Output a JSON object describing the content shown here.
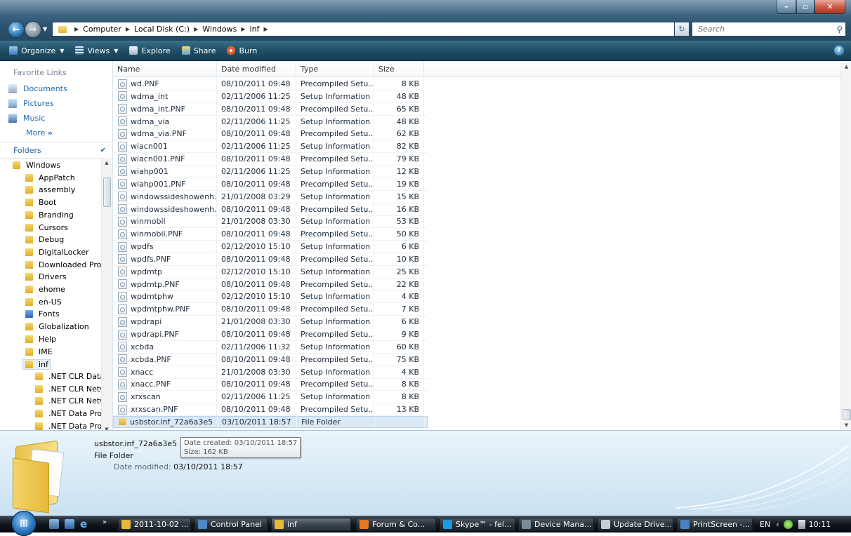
{
  "address": {
    "crumbs": [
      "Computer",
      "Local Disk (C:)",
      "Windows",
      "inf"
    ],
    "search_placeholder": "Search"
  },
  "toolbar": {
    "organize": "Organize",
    "views": "Views",
    "explore": "Explore",
    "share": "Share",
    "burn": "Burn"
  },
  "favorites": {
    "title": "Favorite Links",
    "items": [
      "Documents",
      "Pictures",
      "Music"
    ],
    "more": "More"
  },
  "folders": {
    "title": "Folders",
    "tree": [
      {
        "label": "Windows",
        "level": 1
      },
      {
        "label": "AppPatch",
        "level": 2
      },
      {
        "label": "assembly",
        "level": 2
      },
      {
        "label": "Boot",
        "level": 2
      },
      {
        "label": "Branding",
        "level": 2
      },
      {
        "label": "Cursors",
        "level": 2
      },
      {
        "label": "Debug",
        "level": 2
      },
      {
        "label": "DigitalLocker",
        "level": 2
      },
      {
        "label": "Downloaded Pro",
        "level": 2
      },
      {
        "label": "Drivers",
        "level": 2
      },
      {
        "label": "ehome",
        "level": 2
      },
      {
        "label": "en-US",
        "level": 2
      },
      {
        "label": "Fonts",
        "level": 2,
        "icon": "fonts"
      },
      {
        "label": "Globalization",
        "level": 2
      },
      {
        "label": "Help",
        "level": 2
      },
      {
        "label": "IME",
        "level": 2
      },
      {
        "label": "inf",
        "level": 2,
        "selected": true
      },
      {
        "label": ".NET CLR Data",
        "level": 3
      },
      {
        "label": ".NET CLR Netw",
        "level": 3
      },
      {
        "label": ".NET CLR Netw",
        "level": 3
      },
      {
        "label": ".NET Data Prov",
        "level": 3
      },
      {
        "label": ".NET Data Prov",
        "level": 3
      }
    ]
  },
  "columns": {
    "name": "Name",
    "date": "Date modified",
    "type": "Type",
    "size": "Size"
  },
  "files": [
    {
      "name": "wd.PNF",
      "date": "08/10/2011 09:48",
      "type": "Precompiled Setu...",
      "size": "8 KB"
    },
    {
      "name": "wdma_int",
      "date": "02/11/2006 11:25",
      "type": "Setup Information",
      "size": "48 KB"
    },
    {
      "name": "wdma_int.PNF",
      "date": "08/10/2011 09:48",
      "type": "Precompiled Setu...",
      "size": "65 KB"
    },
    {
      "name": "wdma_via",
      "date": "02/11/2006 11:25",
      "type": "Setup Information",
      "size": "48 KB"
    },
    {
      "name": "wdma_via.PNF",
      "date": "08/10/2011 09:48",
      "type": "Precompiled Setu...",
      "size": "62 KB"
    },
    {
      "name": "wiacn001",
      "date": "02/11/2006 11:25",
      "type": "Setup Information",
      "size": "82 KB"
    },
    {
      "name": "wiacn001.PNF",
      "date": "08/10/2011 09:48",
      "type": "Precompiled Setu...",
      "size": "79 KB"
    },
    {
      "name": "wiahp001",
      "date": "02/11/2006 11:25",
      "type": "Setup Information",
      "size": "12 KB"
    },
    {
      "name": "wiahp001.PNF",
      "date": "08/10/2011 09:48",
      "type": "Precompiled Setu...",
      "size": "19 KB"
    },
    {
      "name": "windowssideshowenh...",
      "date": "21/01/2008 03:29",
      "type": "Setup Information",
      "size": "15 KB"
    },
    {
      "name": "windowssideshowenh...",
      "date": "08/10/2011 09:48",
      "type": "Precompiled Setu...",
      "size": "16 KB"
    },
    {
      "name": "winmobil",
      "date": "21/01/2008 03:30",
      "type": "Setup Information",
      "size": "53 KB"
    },
    {
      "name": "winmobil.PNF",
      "date": "08/10/2011 09:48",
      "type": "Precompiled Setu...",
      "size": "50 KB"
    },
    {
      "name": "wpdfs",
      "date": "02/12/2010 15:10",
      "type": "Setup Information",
      "size": "6 KB"
    },
    {
      "name": "wpdfs.PNF",
      "date": "08/10/2011 09:48",
      "type": "Precompiled Setu...",
      "size": "10 KB"
    },
    {
      "name": "wpdmtp",
      "date": "02/12/2010 15:10",
      "type": "Setup Information",
      "size": "25 KB"
    },
    {
      "name": "wpdmtp.PNF",
      "date": "08/10/2011 09:48",
      "type": "Precompiled Setu...",
      "size": "22 KB"
    },
    {
      "name": "wpdmtphw",
      "date": "02/12/2010 15:10",
      "type": "Setup Information",
      "size": "4 KB"
    },
    {
      "name": "wpdmtphw.PNF",
      "date": "08/10/2011 09:48",
      "type": "Precompiled Setu...",
      "size": "7 KB"
    },
    {
      "name": "wpdrapi",
      "date": "21/01/2008 03:30",
      "type": "Setup Information",
      "size": "6 KB"
    },
    {
      "name": "wpdrapi.PNF",
      "date": "08/10/2011 09:48",
      "type": "Precompiled Setu...",
      "size": "9 KB"
    },
    {
      "name": "xcbda",
      "date": "02/11/2006 11:32",
      "type": "Setup Information",
      "size": "60 KB"
    },
    {
      "name": "xcbda.PNF",
      "date": "08/10/2011 09:48",
      "type": "Precompiled Setu...",
      "size": "75 KB"
    },
    {
      "name": "xnacc",
      "date": "21/01/2008 03:30",
      "type": "Setup Information",
      "size": "4 KB"
    },
    {
      "name": "xnacc.PNF",
      "date": "08/10/2011 09:48",
      "type": "Precompiled Setu...",
      "size": "8 KB"
    },
    {
      "name": "xrxscan",
      "date": "02/11/2006 11:25",
      "type": "Setup Information",
      "size": "8 KB"
    },
    {
      "name": "xrxscan.PNF",
      "date": "08/10/2011 09:48",
      "type": "Precompiled Setu...",
      "size": "13 KB"
    },
    {
      "name": "usbstor.inf_72a6a3e5",
      "date": "03/10/2011 18:57",
      "type": "File Folder",
      "size": "",
      "folder": true,
      "selected": true
    }
  ],
  "details": {
    "name": "usbstor.inf_72a6a3e5",
    "type": "File Folder",
    "modified_label": "Date modified:",
    "modified_value": "03/10/2011 18:57",
    "tooltip_created": "Date created: 03/10/2011 18:57",
    "tooltip_size": "Size: 162 KB"
  },
  "taskbar": {
    "tasks": [
      {
        "label": "2011-10-02 ...",
        "color": "#e6b83a"
      },
      {
        "label": "Control Panel",
        "color": "#4f86c6"
      },
      {
        "label": "inf",
        "color": "#e6b83a",
        "active": true
      },
      {
        "label": "Forum & Co...",
        "color": "#e8761f"
      },
      {
        "label": "Skype™ - fel...",
        "color": "#1a9be0"
      },
      {
        "label": "Device Mana...",
        "color": "#7a8a9a"
      },
      {
        "label": "Update Drive...",
        "color": "#c9ced3"
      },
      {
        "label": "PrintScreen -...",
        "color": "#4a7fc0"
      }
    ],
    "lang": "EN",
    "clock": "10:11"
  }
}
